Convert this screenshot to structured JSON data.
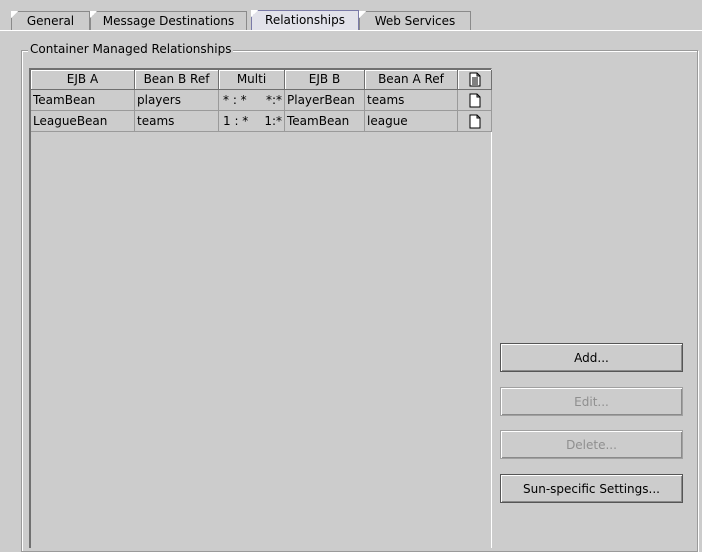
{
  "tabs": [
    {
      "label": "General",
      "active": false
    },
    {
      "label": "Message Destinations",
      "active": false
    },
    {
      "label": "Relationships",
      "active": true
    },
    {
      "label": "Web Services",
      "active": false
    }
  ],
  "group": {
    "title": "Container Managed Relationships"
  },
  "table": {
    "columns": [
      "EJB A",
      "Bean B Ref",
      "Multi",
      "EJB B",
      "Bean A Ref"
    ],
    "last_column_icon": "document-icon",
    "rows": [
      {
        "ejb_a": "TeamBean",
        "bean_b_ref": "players",
        "multi_left": "* : *",
        "multi_right": "*:*",
        "ejb_b": "PlayerBean",
        "bean_a_ref": "teams"
      },
      {
        "ejb_a": "LeagueBean",
        "bean_b_ref": "teams",
        "multi_left": "1 : *",
        "multi_right": "1:*",
        "ejb_b": "TeamBean",
        "bean_a_ref": "league"
      }
    ]
  },
  "buttons": {
    "add": "Add...",
    "edit": "Edit...",
    "delete": "Delete...",
    "sun_settings": "Sun-specific Settings..."
  }
}
